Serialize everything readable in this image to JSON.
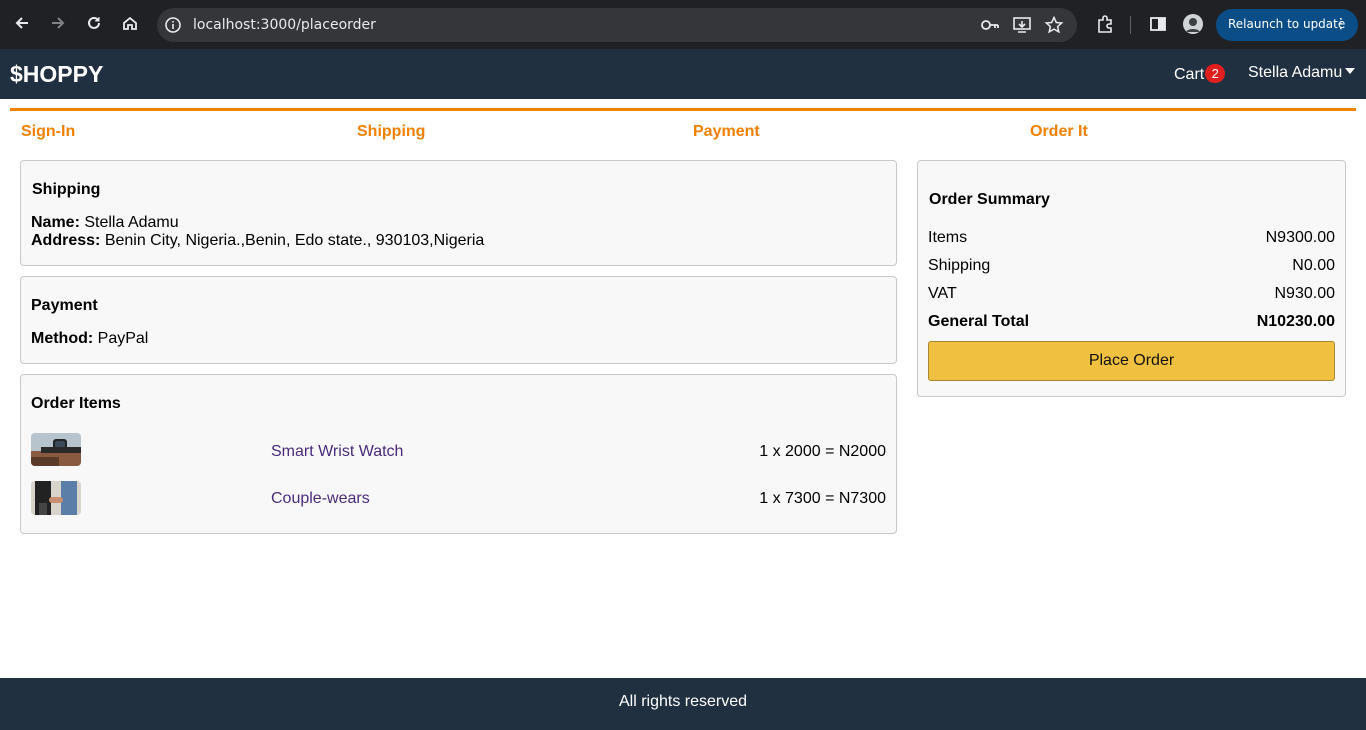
{
  "browser": {
    "url": "localhost:3000/placeorder",
    "relaunch_label": "Relaunch to update",
    "menu_glyph": "⋮"
  },
  "header": {
    "brand": "$HOPPY",
    "cart_label": "Cart",
    "cart_count": "2",
    "user_name": "Stella Adamu"
  },
  "steps": [
    "Sign-In",
    "Shipping",
    "Payment",
    "Order It"
  ],
  "shipping": {
    "title": "Shipping",
    "name_label": "Name:",
    "name": "Stella Adamu",
    "address_label": "Address:",
    "address": "Benin City, Nigeria.,Benin, Edo state., 930103,Nigeria"
  },
  "payment": {
    "title": "Payment",
    "method_label": "Method:",
    "method": "PayPal"
  },
  "order_items": {
    "title": "Order Items",
    "items": [
      {
        "name": "Smart Wrist Watch",
        "price": "1 x 2000 = N2000"
      },
      {
        "name": "Couple-wears",
        "price": "1 x 7300 = N7300"
      }
    ]
  },
  "summary": {
    "title": "Order Summary",
    "rows": [
      {
        "label": "Items",
        "value": "N9300.00"
      },
      {
        "label": "Shipping",
        "value": "N0.00"
      },
      {
        "label": "VAT",
        "value": "N930.00"
      },
      {
        "label": "General Total",
        "value": "N10230.00"
      }
    ],
    "button": "Place Order"
  },
  "footer": "All rights reserved",
  "colors": {
    "header_bg": "#203040",
    "accent": "#f08000",
    "button": "#f0c040",
    "badge": "#e0201e",
    "link": "#4a2a7a"
  }
}
